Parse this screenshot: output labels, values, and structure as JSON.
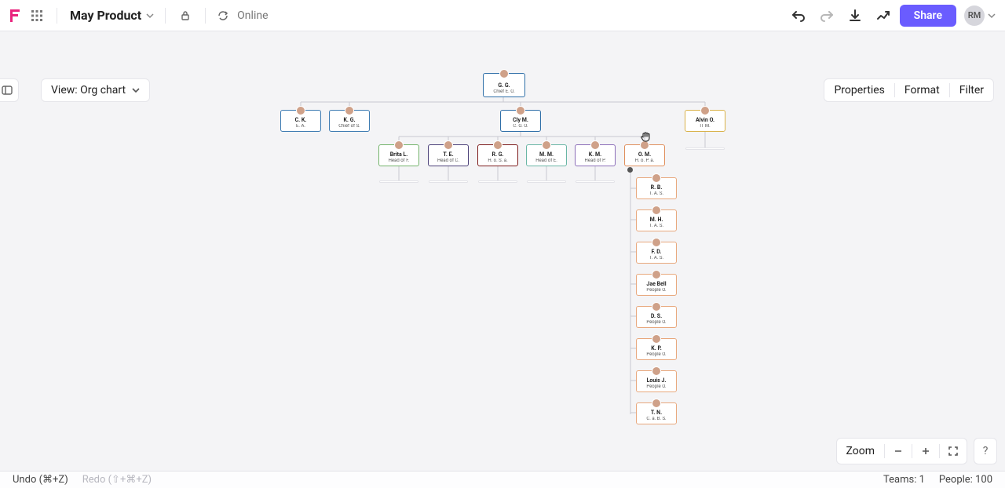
{
  "header": {
    "doc_title": "May Product",
    "online_label": "Online",
    "share_label": "Share",
    "user_initials": "RM"
  },
  "viewbar": {
    "view_label": "View: Org chart",
    "tabs": {
      "properties": "Properties",
      "format": "Format",
      "filter": "Filter"
    }
  },
  "zoom": {
    "label": "Zoom"
  },
  "help": {
    "label": "?"
  },
  "status": {
    "undo": "Undo (⌘+Z)",
    "redo": "Redo (⇧+⌘+Z)",
    "teams_lbl": "Teams:",
    "teams_val": "1",
    "people_lbl": "People:",
    "people_val": "100"
  },
  "colors": {
    "blue": "#2f6fa8",
    "blue2": "#3d7bb2",
    "green": "#73b36b",
    "purpleD": "#4a3f78",
    "darkRed": "#7d1b1b",
    "teal": "#69b6a5",
    "purple": "#8b6db8",
    "orange": "#e0905e",
    "orangeL": "#e8a87d",
    "yellow": "#d9b24a"
  },
  "nodes": {
    "root": {
      "name": "G. G.",
      "role": "Chief E. O.",
      "colorKey": "blue"
    },
    "row2": [
      {
        "name": "C. K.",
        "role": "E. A.",
        "colorKey": "blue2"
      },
      {
        "name": "K. G.",
        "role": "Chief of S.",
        "colorKey": "blue2"
      },
      {
        "name": "Cly M.",
        "role": "C. O. O.",
        "colorKey": "blue"
      },
      {
        "name": "Alvin O.",
        "role": "IT M.",
        "colorKey": "yellow"
      }
    ],
    "row3": [
      {
        "name": "Brita L.",
        "role": "Head of F.",
        "colorKey": "green"
      },
      {
        "name": "T. E.",
        "role": "Head of C.",
        "colorKey": "purpleD"
      },
      {
        "name": "R. G.",
        "role": "H. o. S. a.",
        "colorKey": "darkRed"
      },
      {
        "name": "M. M.",
        "role": "Head of E.",
        "colorKey": "teal"
      },
      {
        "name": "K. M.",
        "role": "Head of P.",
        "colorKey": "purple"
      },
      {
        "name": "O. M.",
        "role": "H. o. P. a.",
        "colorKey": "orange"
      }
    ],
    "column": [
      {
        "name": "R. B.",
        "role": "T. A. S.",
        "colorKey": "orangeL"
      },
      {
        "name": "M. H.",
        "role": "T. A. S.",
        "colorKey": "orangeL"
      },
      {
        "name": "F. D.",
        "role": "T. A. S.",
        "colorKey": "orangeL"
      },
      {
        "name": "Jae Bell",
        "role": "People O.",
        "colorKey": "orangeL"
      },
      {
        "name": "D. S.",
        "role": "People O.",
        "colorKey": "orangeL"
      },
      {
        "name": "K. P.",
        "role": "People O.",
        "colorKey": "orangeL"
      },
      {
        "name": "Louis J.",
        "role": "People O.",
        "colorKey": "orangeL"
      },
      {
        "name": "T. N.",
        "role": "C. a. B. S.",
        "colorKey": "orangeL"
      }
    ]
  }
}
